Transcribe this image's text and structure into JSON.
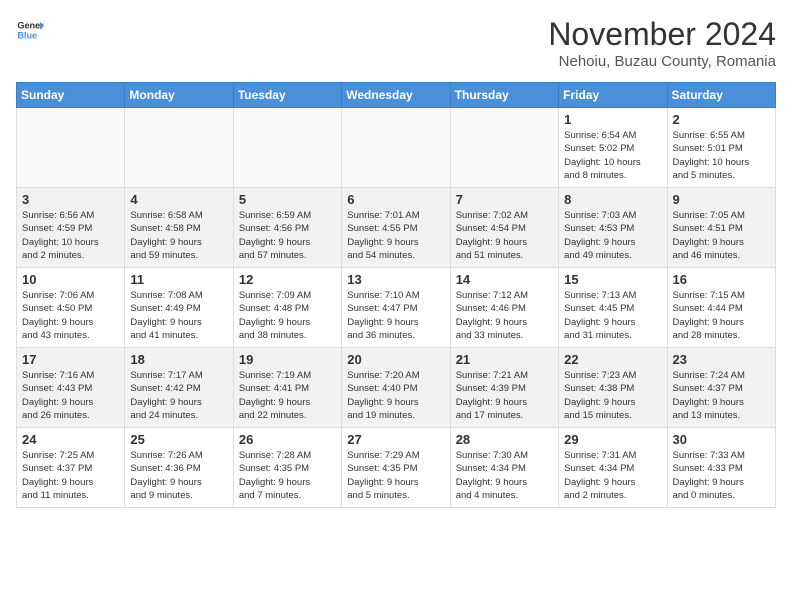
{
  "header": {
    "logo_general": "General",
    "logo_blue": "Blue",
    "title": "November 2024",
    "subtitle": "Nehoiu, Buzau County, Romania"
  },
  "weekdays": [
    "Sunday",
    "Monday",
    "Tuesday",
    "Wednesday",
    "Thursday",
    "Friday",
    "Saturday"
  ],
  "weeks": [
    [
      {
        "day": "",
        "info": ""
      },
      {
        "day": "",
        "info": ""
      },
      {
        "day": "",
        "info": ""
      },
      {
        "day": "",
        "info": ""
      },
      {
        "day": "",
        "info": ""
      },
      {
        "day": "1",
        "info": "Sunrise: 6:54 AM\nSunset: 5:02 PM\nDaylight: 10 hours\nand 8 minutes."
      },
      {
        "day": "2",
        "info": "Sunrise: 6:55 AM\nSunset: 5:01 PM\nDaylight: 10 hours\nand 5 minutes."
      }
    ],
    [
      {
        "day": "3",
        "info": "Sunrise: 6:56 AM\nSunset: 4:59 PM\nDaylight: 10 hours\nand 2 minutes."
      },
      {
        "day": "4",
        "info": "Sunrise: 6:58 AM\nSunset: 4:58 PM\nDaylight: 9 hours\nand 59 minutes."
      },
      {
        "day": "5",
        "info": "Sunrise: 6:59 AM\nSunset: 4:56 PM\nDaylight: 9 hours\nand 57 minutes."
      },
      {
        "day": "6",
        "info": "Sunrise: 7:01 AM\nSunset: 4:55 PM\nDaylight: 9 hours\nand 54 minutes."
      },
      {
        "day": "7",
        "info": "Sunrise: 7:02 AM\nSunset: 4:54 PM\nDaylight: 9 hours\nand 51 minutes."
      },
      {
        "day": "8",
        "info": "Sunrise: 7:03 AM\nSunset: 4:53 PM\nDaylight: 9 hours\nand 49 minutes."
      },
      {
        "day": "9",
        "info": "Sunrise: 7:05 AM\nSunset: 4:51 PM\nDaylight: 9 hours\nand 46 minutes."
      }
    ],
    [
      {
        "day": "10",
        "info": "Sunrise: 7:06 AM\nSunset: 4:50 PM\nDaylight: 9 hours\nand 43 minutes."
      },
      {
        "day": "11",
        "info": "Sunrise: 7:08 AM\nSunset: 4:49 PM\nDaylight: 9 hours\nand 41 minutes."
      },
      {
        "day": "12",
        "info": "Sunrise: 7:09 AM\nSunset: 4:48 PM\nDaylight: 9 hours\nand 38 minutes."
      },
      {
        "day": "13",
        "info": "Sunrise: 7:10 AM\nSunset: 4:47 PM\nDaylight: 9 hours\nand 36 minutes."
      },
      {
        "day": "14",
        "info": "Sunrise: 7:12 AM\nSunset: 4:46 PM\nDaylight: 9 hours\nand 33 minutes."
      },
      {
        "day": "15",
        "info": "Sunrise: 7:13 AM\nSunset: 4:45 PM\nDaylight: 9 hours\nand 31 minutes."
      },
      {
        "day": "16",
        "info": "Sunrise: 7:15 AM\nSunset: 4:44 PM\nDaylight: 9 hours\nand 28 minutes."
      }
    ],
    [
      {
        "day": "17",
        "info": "Sunrise: 7:16 AM\nSunset: 4:43 PM\nDaylight: 9 hours\nand 26 minutes."
      },
      {
        "day": "18",
        "info": "Sunrise: 7:17 AM\nSunset: 4:42 PM\nDaylight: 9 hours\nand 24 minutes."
      },
      {
        "day": "19",
        "info": "Sunrise: 7:19 AM\nSunset: 4:41 PM\nDaylight: 9 hours\nand 22 minutes."
      },
      {
        "day": "20",
        "info": "Sunrise: 7:20 AM\nSunset: 4:40 PM\nDaylight: 9 hours\nand 19 minutes."
      },
      {
        "day": "21",
        "info": "Sunrise: 7:21 AM\nSunset: 4:39 PM\nDaylight: 9 hours\nand 17 minutes."
      },
      {
        "day": "22",
        "info": "Sunrise: 7:23 AM\nSunset: 4:38 PM\nDaylight: 9 hours\nand 15 minutes."
      },
      {
        "day": "23",
        "info": "Sunrise: 7:24 AM\nSunset: 4:37 PM\nDaylight: 9 hours\nand 13 minutes."
      }
    ],
    [
      {
        "day": "24",
        "info": "Sunrise: 7:25 AM\nSunset: 4:37 PM\nDaylight: 9 hours\nand 11 minutes."
      },
      {
        "day": "25",
        "info": "Sunrise: 7:26 AM\nSunset: 4:36 PM\nDaylight: 9 hours\nand 9 minutes."
      },
      {
        "day": "26",
        "info": "Sunrise: 7:28 AM\nSunset: 4:35 PM\nDaylight: 9 hours\nand 7 minutes."
      },
      {
        "day": "27",
        "info": "Sunrise: 7:29 AM\nSunset: 4:35 PM\nDaylight: 9 hours\nand 5 minutes."
      },
      {
        "day": "28",
        "info": "Sunrise: 7:30 AM\nSunset: 4:34 PM\nDaylight: 9 hours\nand 4 minutes."
      },
      {
        "day": "29",
        "info": "Sunrise: 7:31 AM\nSunset: 4:34 PM\nDaylight: 9 hours\nand 2 minutes."
      },
      {
        "day": "30",
        "info": "Sunrise: 7:33 AM\nSunset: 4:33 PM\nDaylight: 9 hours\nand 0 minutes."
      }
    ]
  ]
}
